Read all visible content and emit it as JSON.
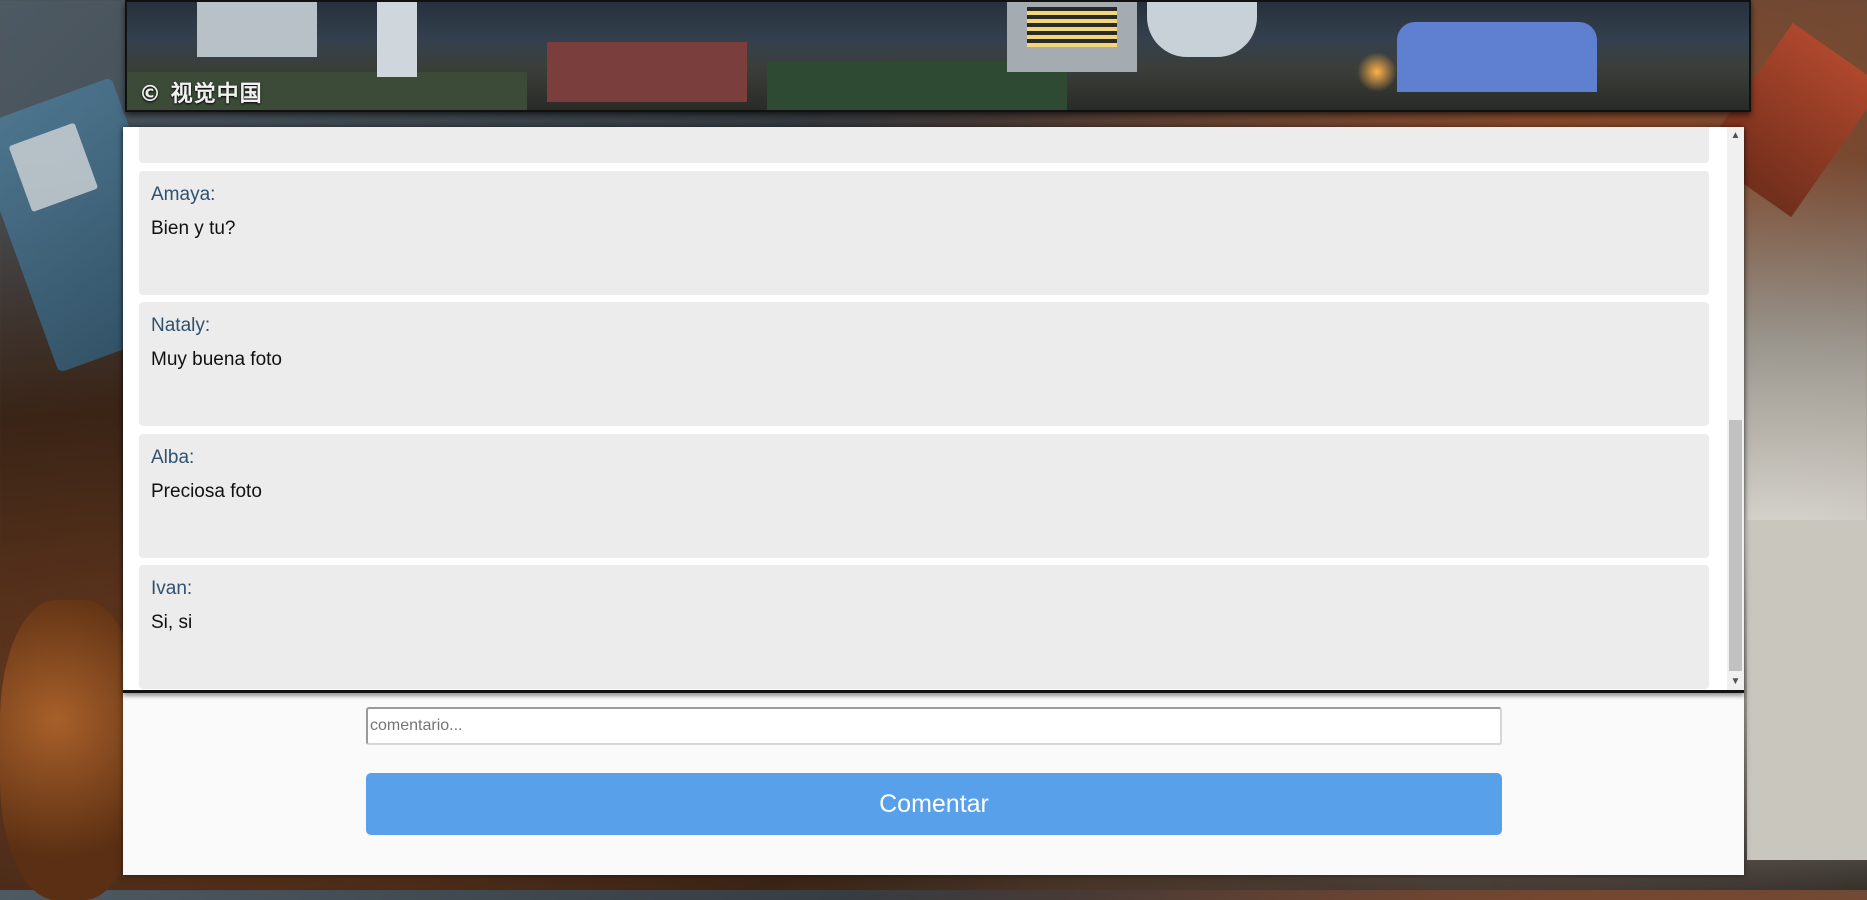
{
  "photo": {
    "watermark": "© 视觉中国"
  },
  "comments": [
    {
      "author": "",
      "text": ""
    },
    {
      "author": "Amaya:",
      "text": "Bien y tu?"
    },
    {
      "author": "Nataly:",
      "text": "Muy buena foto"
    },
    {
      "author": "Alba:",
      "text": "Preciosa foto"
    },
    {
      "author": "Ivan:",
      "text": "Si, si"
    }
  ],
  "form": {
    "input_placeholder": "comentario...",
    "input_value": "",
    "submit_label": "Comentar"
  },
  "icons": {
    "scroll_up": "triangle-up-icon",
    "scroll_down": "triangle-down-icon"
  },
  "colors": {
    "button": "#58a0ea",
    "author": "#2f5170",
    "comment_bg": "#ececec"
  }
}
